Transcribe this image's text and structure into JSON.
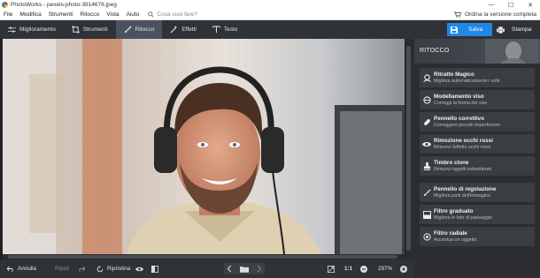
{
  "window": {
    "title": "PhotoWorks - pexels-photo-3914678.jpeg",
    "minimize": "—",
    "maximize": "☐",
    "close": "✕"
  },
  "menu": {
    "items": [
      "File",
      "Modifica",
      "Strumenti",
      "Ritocco",
      "Vista",
      "Aiuto"
    ],
    "search_placeholder": "Cosa vuoi fare?",
    "upgrade_label": "Ordina la versione completa"
  },
  "toolbar": {
    "tabs": [
      {
        "label": "Miglioramento",
        "icon": "sliders-icon"
      },
      {
        "label": "Strumenti",
        "icon": "crop-icon"
      },
      {
        "label": "Ritocco",
        "icon": "brush-icon",
        "active": true
      },
      {
        "label": "Effetti",
        "icon": "magic-wand-icon"
      },
      {
        "label": "Testo",
        "icon": "text-icon"
      }
    ],
    "save_label": "Salva",
    "print_label": "Stampa"
  },
  "panel": {
    "title": "RITOCCO",
    "tools": [
      {
        "name": "Ritratto Magico",
        "desc": "Migliora automaticamente i volti",
        "icon": "magic-portrait-icon"
      },
      {
        "name": "Modellamento viso",
        "desc": "Correggi la forma del viso",
        "icon": "face-shape-icon"
      },
      {
        "name": "Pennello correttivo",
        "desc": "Correggere piccole imperfezioni",
        "icon": "bandage-icon"
      },
      {
        "name": "Rimozione occhi rossi",
        "desc": "Rimuovi l'effetto occhi rossi",
        "icon": "eye-icon"
      },
      {
        "name": "Timbro clone",
        "desc": "Rimuovi oggetti indesiderati",
        "icon": "stamp-icon"
      },
      {
        "name": "Pennello di regolazione",
        "desc": "Migliora parti dell'immagine",
        "icon": "brush-icon"
      },
      {
        "name": "Filtro graduato",
        "desc": "Migliora le foto di paesaggio",
        "icon": "gradient-filter-icon"
      },
      {
        "name": "Filtro radiale",
        "desc": "Accentua un oggetto",
        "icon": "radial-filter-icon"
      }
    ]
  },
  "bottom": {
    "undo_label": "Annulla",
    "redo_label": "Ripeti",
    "reset_label": "Ripristina",
    "zoom_ratio": "1:1",
    "zoom_level": "297%"
  }
}
